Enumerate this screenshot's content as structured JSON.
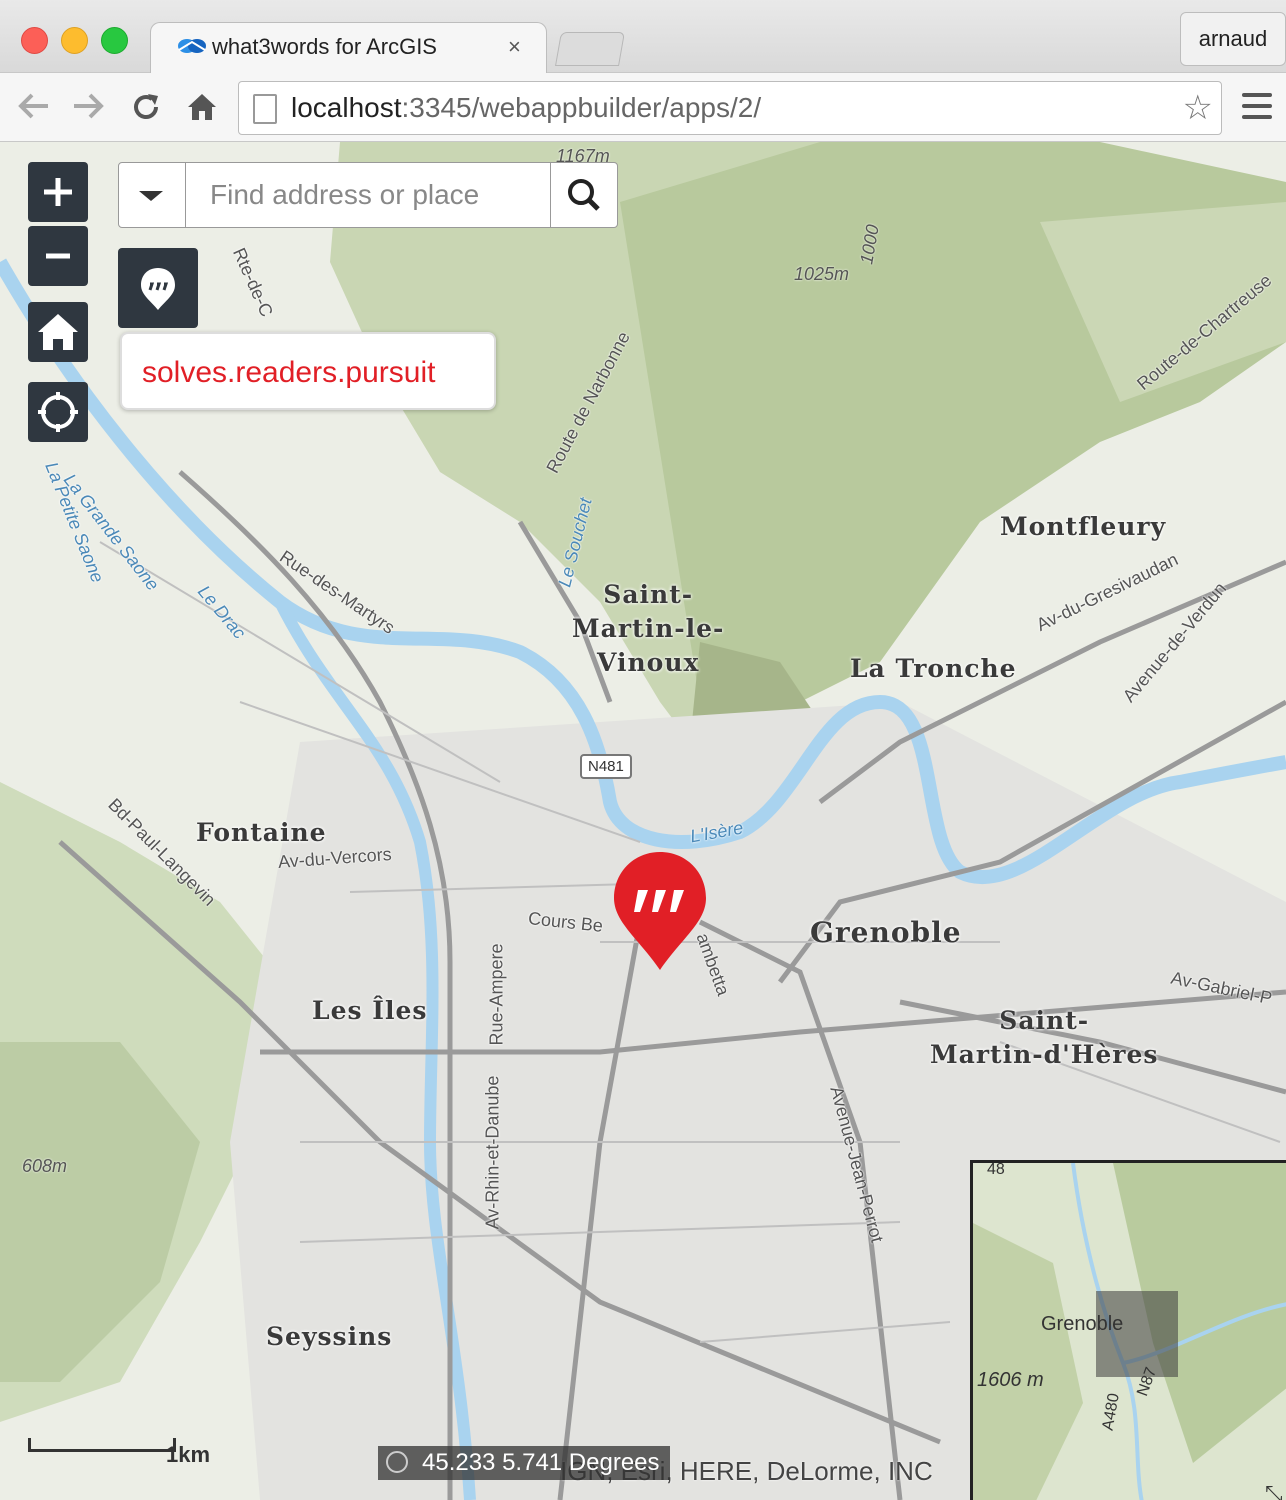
{
  "browser": {
    "tab_title": "what3words for ArcGIS",
    "tab_close": "×",
    "profile_name": "arnaud",
    "url_host": "localhost",
    "url_path": ":3345/webappbuilder/apps/2/"
  },
  "map": {
    "search_placeholder": "Find address or place",
    "w3w_address": "solves.readers.pursuit",
    "places": {
      "saint_martin": "Saint-\nMartin-le-\nVinoux",
      "montfleury": "Montfleury",
      "la_tronche": "La Tronche",
      "fontaine": "Fontaine",
      "grenoble": "Grenoble",
      "saint_martin_dheres": "Saint-\nMartin-d'Hères",
      "les_iles": "Les Îles",
      "seyssins": "Seyssins"
    },
    "roads": {
      "route_narbonne": "Route de Narbonne",
      "rue_martyrs": "Rue-des-Martyrs",
      "av_gresivaudan": "Av-du-Gresivaudan",
      "av_verdun": "Avenue-de-Verdun",
      "route_chartreuse": "Route-de-Chartreuse",
      "bd_langevin": "Bd-Paul-Langevin",
      "av_vercors": "Av-du-Vercors",
      "cours_be": "Cours Be",
      "gambetta": "ambetta",
      "rue_ampere": "Rue-Ampere",
      "av_rhin": "Av-Rhin-et-Danube",
      "av_jean_perrot": "Avenue-Jean-Perrot",
      "av_gabriel": "Av-Gabriel-P",
      "grande_saone": "La Grande Saone",
      "petite_saone": "La Petite Saone",
      "le_drac": "Le Drac",
      "l_isere": "L'Isère",
      "rte_de_c": "Rte-de-C",
      "le_souchet": "Le Souchet"
    },
    "elevations": {
      "e1167": "1167m",
      "e1025": "1025m",
      "e1000": "1000",
      "e608": "608m"
    },
    "shield": "N481",
    "overview": {
      "label": "Grenoble",
      "elevation": "1606 m",
      "road1": "A480",
      "road2": "N87",
      "road3": "48",
      "toggle": "⤡"
    },
    "scale_label": "1km",
    "coordinates": "45.233 5.741 Degrees",
    "attribution": "IGN, Esri, HERE, DeLorme, INC",
    "colors": {
      "w3w_red": "#e11f26",
      "button_dark": "#2f3740",
      "river": "#a9d3ef"
    }
  }
}
